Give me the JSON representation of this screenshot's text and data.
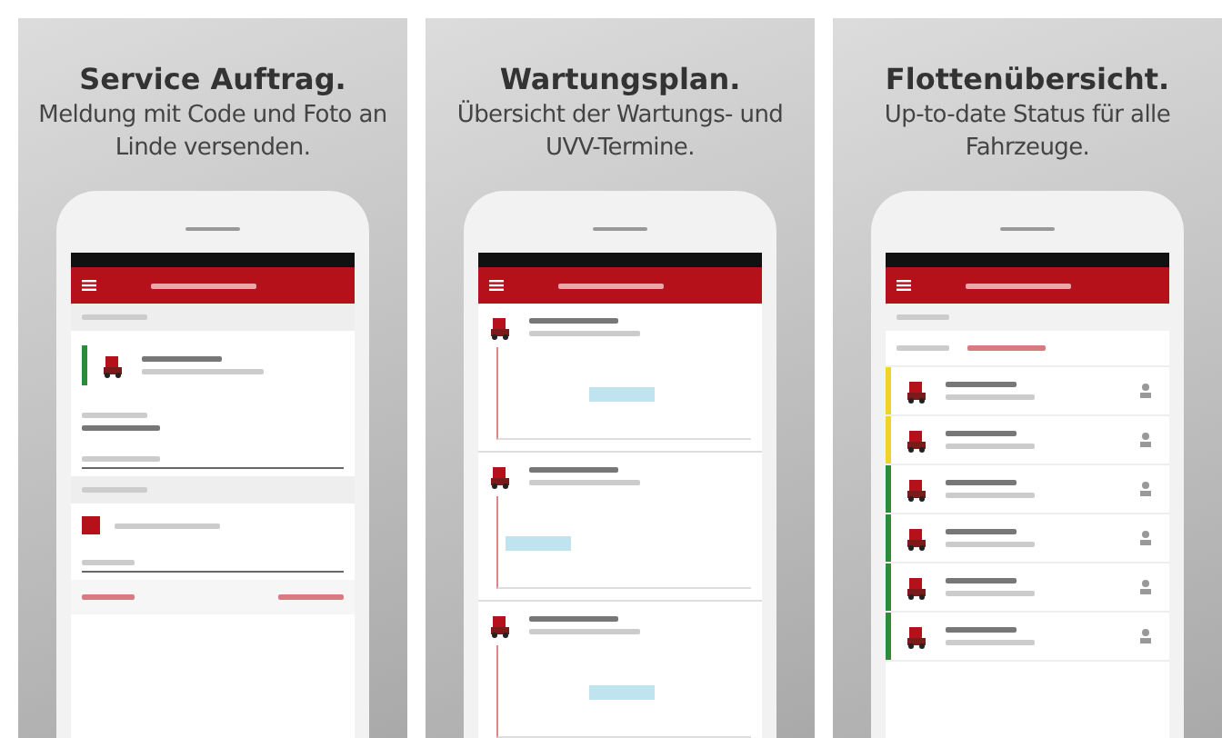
{
  "panels": [
    {
      "title": "Service Auftrag.",
      "subtitle": "Meldung mit Code und Foto an Linde versenden.",
      "screen": {
        "kind": "service",
        "cards": [
          {
            "color": "#2e8b3a"
          }
        ],
        "checkbox": {
          "checked": true
        }
      }
    },
    {
      "title": "Wartungsplan.",
      "subtitle": "Übersicht der Wartungs- und UVV-Termine.",
      "screen": {
        "kind": "schedule"
      }
    },
    {
      "title": "Flottenübersicht.",
      "subtitle": "Up-to-date Status für alle Fahrzeuge.",
      "screen": {
        "kind": "fleet",
        "rows": [
          {
            "color": "#f2d32a"
          },
          {
            "color": "#f2d32a"
          },
          {
            "color": "#2e8b3a"
          },
          {
            "color": "#2e8b3a"
          },
          {
            "color": "#2e8b3a"
          },
          {
            "color": "#2e8b3a"
          }
        ]
      }
    }
  ]
}
